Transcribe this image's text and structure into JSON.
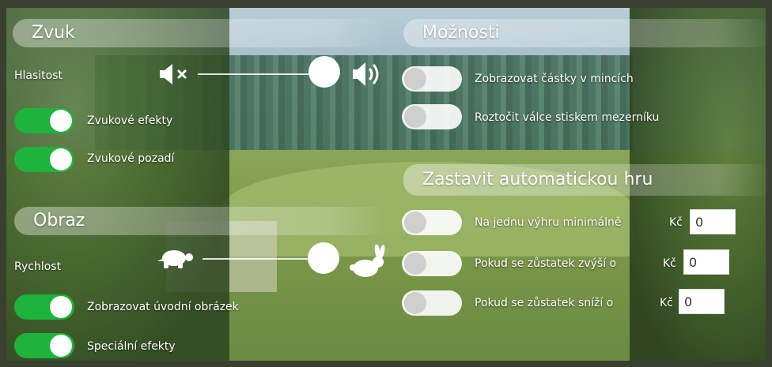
{
  "sound": {
    "title": "Zvuk",
    "volume_label": "Hlasitost",
    "volume_level": 0.9,
    "effects_label": "Zvukové efekty",
    "effects_on": true,
    "background_label": "Zvukové pozadí",
    "background_on": true
  },
  "image": {
    "title": "Obraz",
    "speed_label": "Rychlost",
    "speed_level": 0.9,
    "intro_label": "Zobrazovat úvodní obrázek",
    "intro_on": true,
    "special_label": "Speciální efekty",
    "special_on": true
  },
  "options": {
    "title": "Možnosti",
    "coins_label": "Zobrazovat částky v mincích",
    "coins_on": false,
    "spacebar_label": "Roztočit válce stiskem mezerníku",
    "spacebar_on": false
  },
  "autoplay": {
    "title": "Zastavit automatickou hru",
    "currency": "Kč",
    "win_label": "Na jednu výhru minimálně",
    "win_on": false,
    "win_value": "0",
    "balance_up_label": "Pokud se zůstatek zvýší o",
    "balance_up_on": false,
    "balance_up_value": "0",
    "balance_down_label": "Pokud se zůstatek sníží o",
    "balance_down_on": false,
    "balance_down_value": "0"
  },
  "icons": {
    "mute": "speaker-mute-icon",
    "loud": "speaker-loud-icon",
    "slow": "turtle-icon",
    "fast": "rabbit-icon"
  },
  "colors": {
    "toggle_on": "#1db33d",
    "toggle_off": "#ffffff"
  }
}
